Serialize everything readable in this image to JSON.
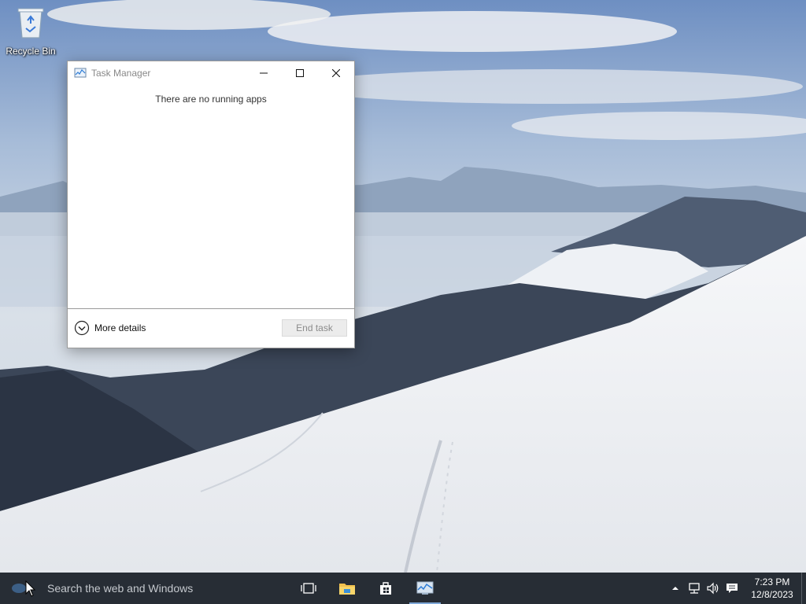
{
  "desktop": {
    "icons": [
      {
        "label": "Recycle Bin",
        "icon": "recycle-bin-icon"
      }
    ]
  },
  "task_manager": {
    "title": "Task Manager",
    "app_icon": "task-manager-icon",
    "controls": {
      "minimize": "minimize-icon",
      "maximize": "maximize-icon",
      "close": "close-icon"
    },
    "empty_message": "There are no running apps",
    "more_details_label": "More details",
    "end_task_label": "End task",
    "end_task_enabled": false
  },
  "taskbar": {
    "search_placeholder": "Search the web and Windows",
    "pinned": [
      {
        "name": "task-view-icon",
        "active": false
      },
      {
        "name": "file-explorer-icon",
        "active": false
      },
      {
        "name": "store-icon",
        "active": false
      },
      {
        "name": "task-manager-icon",
        "active": true
      }
    ],
    "tray": {
      "icons": [
        "chevron-up-icon",
        "network-icon",
        "volume-icon",
        "action-center-icon"
      ],
      "time": "7:23 PM",
      "date": "12/8/2023"
    },
    "colors": {
      "background": "#272d35",
      "active_indicator": "#7fa8d8"
    }
  }
}
